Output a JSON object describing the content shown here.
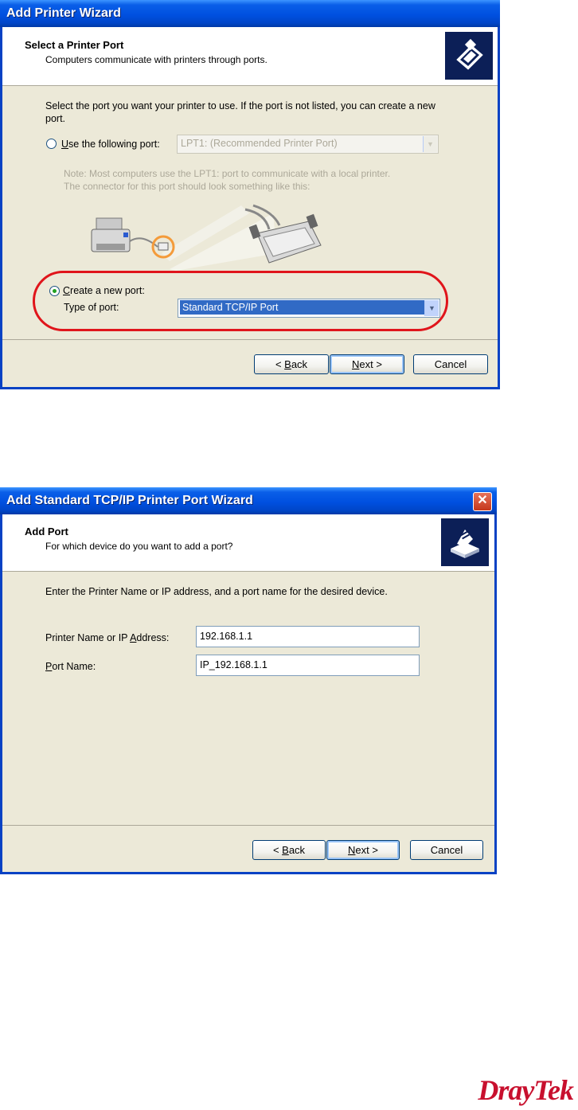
{
  "dialog1": {
    "title": "Add Printer Wizard",
    "header_title": "Select a Printer Port",
    "header_subtitle": "Computers communicate with printers through ports.",
    "instruction": "Select the port you want your printer to use.  If the port is not listed, you can create a new port.",
    "option_existing": {
      "label_prefix": "U",
      "label_rest": "se the following port:",
      "value": "LPT1: (Recommended Printer Port)",
      "selected": false
    },
    "note_line1": "Note: Most computers use the LPT1: port to communicate with a local printer.",
    "note_line2": "The connector for this port should look something like this:",
    "option_new": {
      "label_prefix": "C",
      "label_rest": "reate a new port:",
      "selected": true
    },
    "type_label": "Type of port:",
    "type_value": "Standard TCP/IP Port",
    "highlight_color": "#e0151b",
    "buttons": {
      "back_pre": "< ",
      "back_u": "B",
      "back_rest": "ack",
      "next_u": "N",
      "next_rest": "ext >",
      "cancel": "Cancel"
    }
  },
  "dialog2": {
    "title": "Add Standard TCP/IP Printer Port Wizard",
    "header_title": "Add Port",
    "header_subtitle": "For which device do you want to add a port?",
    "instruction": "Enter the Printer Name or IP address, and a port name for the desired device.",
    "printer_label_pre": "Printer Name or IP ",
    "printer_label_u": "A",
    "printer_label_rest": "ddress:",
    "printer_value": "192.168.1.1",
    "port_label_u": "P",
    "port_label_rest": "ort Name:",
    "port_value": "IP_192.168.1.1",
    "buttons": {
      "back_pre": "< ",
      "back_u": "B",
      "back_rest": "ack",
      "next_u": "N",
      "next_rest": "ext >",
      "cancel": "Cancel"
    }
  },
  "brand": {
    "logo_text": "DrayTek",
    "color": "#c8102e"
  }
}
